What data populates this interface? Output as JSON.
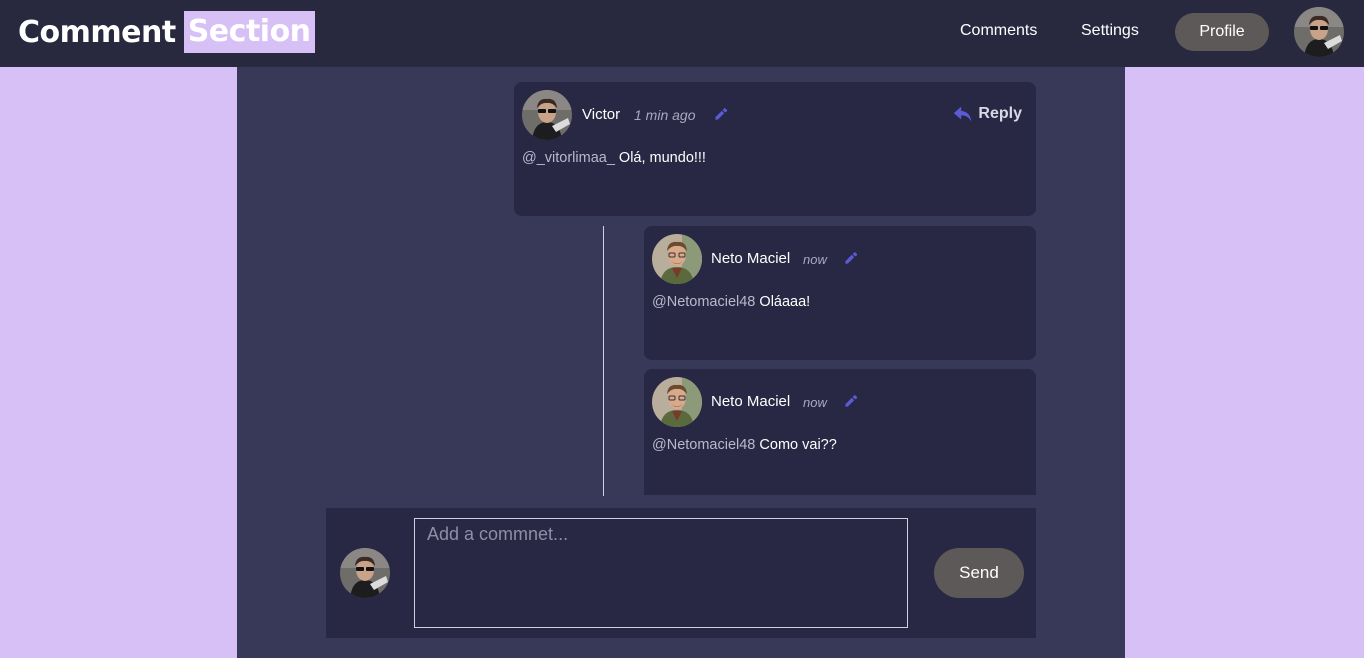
{
  "header": {
    "brand_part1": "Comment",
    "brand_part2": "Section",
    "nav": {
      "comments": "Comments",
      "settings": "Settings",
      "profile": "Profile"
    }
  },
  "comments": [
    {
      "user": "Victor",
      "time": "1 min ago",
      "mention": "@_vitorlimaa_",
      "text": "Olá, mundo!!!",
      "reply_label": "Reply"
    },
    {
      "user": "Neto Maciel",
      "time": "now",
      "mention": "@Netomaciel48",
      "text": "Oláaaa!"
    },
    {
      "user": "Neto Maciel",
      "time": "now",
      "mention": "@Netomaciel48",
      "text": "Como vai??"
    }
  ],
  "composer": {
    "placeholder": "Add a commnet...",
    "send_label": "Send"
  },
  "colors": {
    "accent": "#5b5bd6",
    "page_bg": "#d7c0f5",
    "panel_bg": "#383858",
    "card_bg": "#282844",
    "button_bg": "#5d5958"
  },
  "icons": {
    "edit": "pencil-icon",
    "reply": "reply-arrow-icon"
  }
}
